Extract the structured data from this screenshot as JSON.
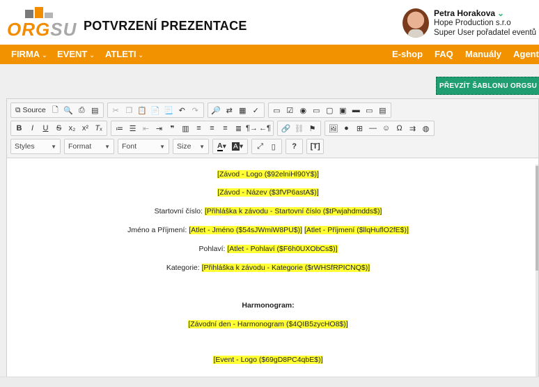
{
  "header": {
    "logo_text_orange": "ORG",
    "logo_text_grey": "SU",
    "page_title": "POTVRZENÍ PREZENTACE"
  },
  "user": {
    "name": "Petra Horakova",
    "company": "Hope Production s.r.o",
    "role": "Super User pořadatel eventů"
  },
  "nav": {
    "left": [
      {
        "label": "FIRMA",
        "arrow": "⌄"
      },
      {
        "label": "EVENT",
        "arrow": "⌄"
      },
      {
        "label": "ATLETI",
        "arrow": "⌄"
      }
    ],
    "right": [
      "E-shop",
      "FAQ",
      "Manuály",
      "Agent"
    ]
  },
  "actions": {
    "take_template": "PŘEVZÍT ŠABLONU ORGSU"
  },
  "toolbar": {
    "source_label": "Source",
    "styles_label": "Styles",
    "format_label": "Format",
    "font_label": "Font",
    "size_label": "Size"
  },
  "content": {
    "logo_tag": "[Závod - Logo ($92elniHl90Y$)]",
    "name_tag": "[Závod - Název ($3fVP6astA$)]",
    "start_label": "Startovní číslo: ",
    "start_tag": "[Přihláška k závodu - Startovní číslo ($tPwjahdmdds$)]",
    "fullname_label": "Jméno a Příjmení: ",
    "firstname_tag": "[Atlet - Jméno ($54sJWmiW8PU$)]",
    "surname_tag": "[Atlet - Příjmení ($llqHuflO2fE$)]",
    "gender_label": "Pohlaví: ",
    "gender_tag": "[Atlet - Pohlaví ($F6h0UXObCs$)]",
    "category_label": "Kategorie: ",
    "category_tag": "[Přihláška k závodu - Kategorie ($rWHSfRPICNQ$)]",
    "schedule_heading": "Harmonogram:",
    "schedule_tag": "[Závodní den - Harmonogram ($4QIB5zycHO8$)]",
    "event_logo_tag": "[Event - Logo ($69gD8PC4qbE$)]"
  }
}
